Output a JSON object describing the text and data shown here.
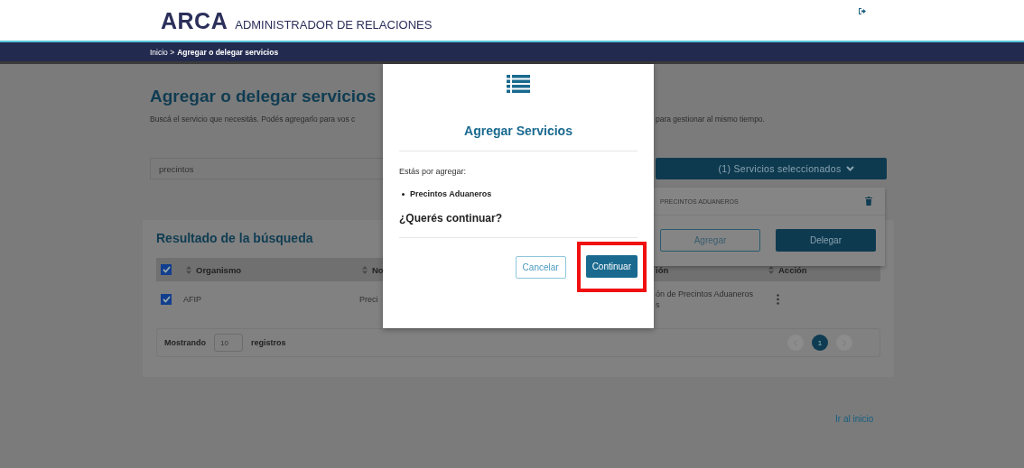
{
  "header": {
    "logo": "ARCA",
    "subtitle": "ADMINISTRADOR DE RELACIONES"
  },
  "breadcrumb": {
    "home": "Inicio >",
    "current": "Agregar o delegar servicios"
  },
  "page": {
    "title": "Agregar o delegar servicios",
    "description_left": "Buscá el servicio que necesitás. Podés agregarlo para vos c",
    "description_right": "para gestionar al mismo tiempo."
  },
  "search": {
    "value": "precintos"
  },
  "selected_services": {
    "label": "(1) Servicios seleccionados",
    "expanded": true,
    "items": [
      "PRECINTOS ADUANEROS"
    ],
    "buttons": [
      {
        "label": "Agregar",
        "kind": "outline"
      },
      {
        "label": "Delegar",
        "kind": "filled"
      }
    ]
  },
  "results": {
    "title": "Resultado de la búsqueda",
    "all_checked": true,
    "columns": [
      {
        "label": "Organismo",
        "sortable": true
      },
      {
        "label": "No",
        "sortable": true
      },
      {
        "label": "ión",
        "sortable": false
      },
      {
        "label": "Acción",
        "sortable": true
      }
    ],
    "rows": [
      {
        "checked": true,
        "cells": [
          [
            "AFIP"
          ],
          [
            "Preci"
          ],
          [
            "ón de Precintos Aduaneros",
            "s"
          ]
        ]
      }
    ],
    "showing_label": "Mostrando",
    "page_size": "10",
    "records_label": "registros",
    "pages": [
      {
        "label": "1",
        "selected": true
      }
    ]
  },
  "footer_link": "Ir al inicio",
  "modal": {
    "title": "Agregar Servicios",
    "intro": "Estás por agregar:",
    "items": [
      "Precintos Aduaneros"
    ],
    "question": "¿Querés continuar?",
    "buttons": [
      {
        "label": "Cancelar",
        "kind": "outline",
        "highlighted": false
      },
      {
        "label": "Continuar",
        "kind": "filled",
        "highlighted": true
      }
    ]
  }
}
